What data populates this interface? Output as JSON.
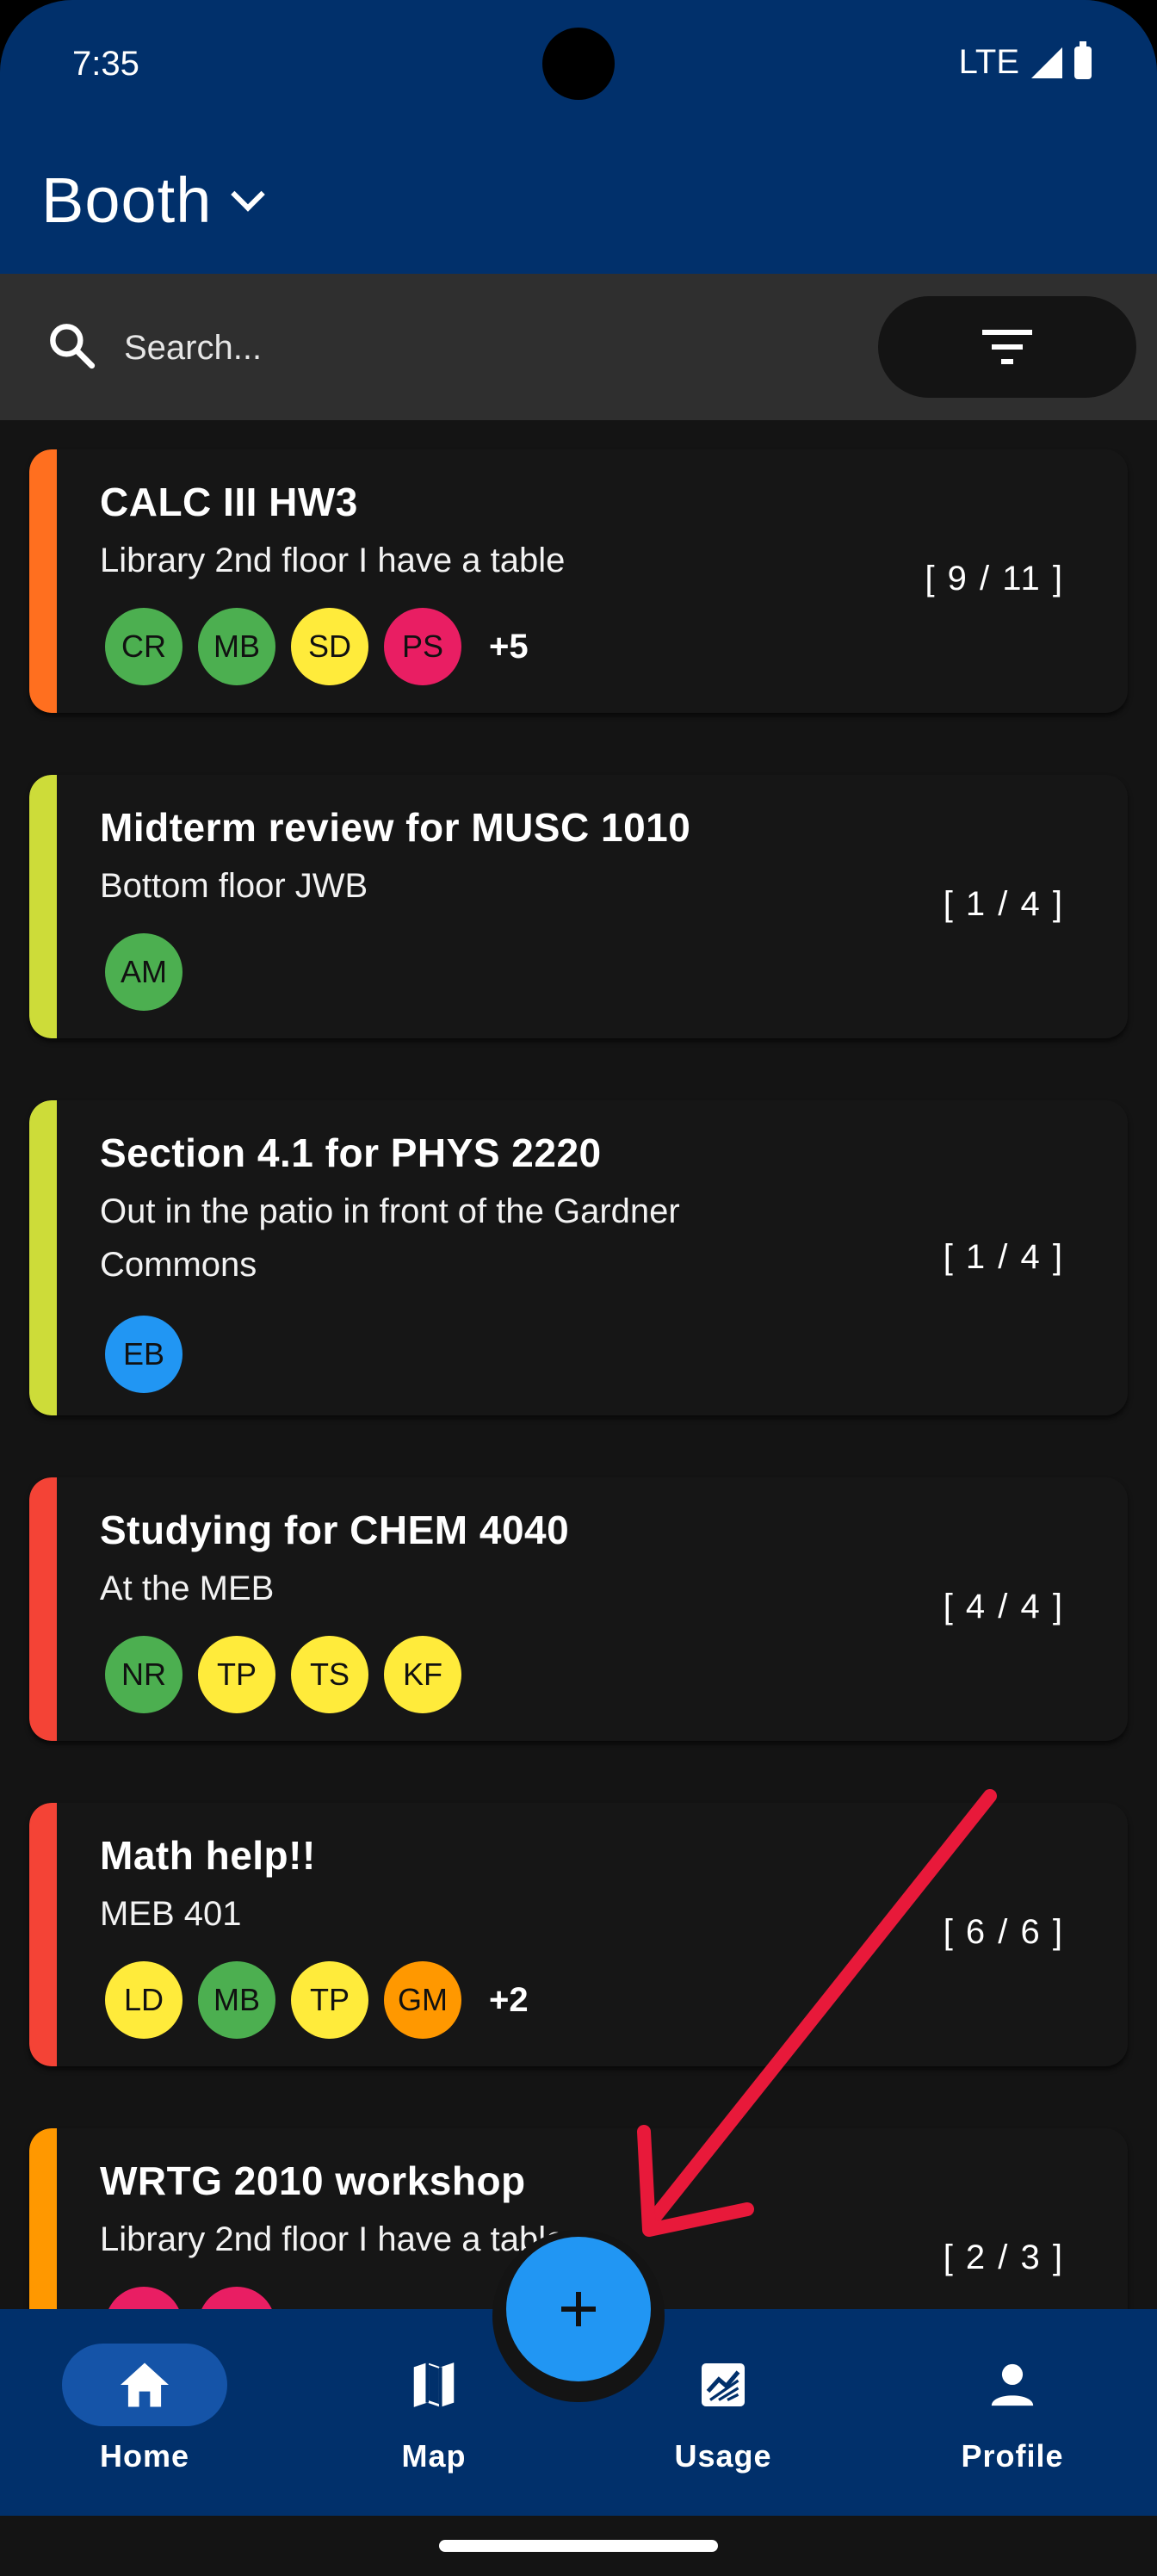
{
  "status_bar": {
    "time": "7:35",
    "network": "LTE"
  },
  "header": {
    "title": "Booth"
  },
  "search": {
    "placeholder": "Search..."
  },
  "colors": {
    "appbar": "#01306b",
    "fab": "#2196f3",
    "orange": "#ff6f1f",
    "lime": "#cddc39",
    "red": "#f44336",
    "amber": "#ff9800",
    "annotation": "#e8193a"
  },
  "cards": [
    {
      "title": "CALC III HW3",
      "location": "Library 2nd floor I have a table",
      "count": "[ 9 / 11 ]",
      "color": "#ff6f1f",
      "avatars": [
        {
          "initials": "CR",
          "color": "#4caf50"
        },
        {
          "initials": "MB",
          "color": "#4caf50"
        },
        {
          "initials": "SD",
          "color": "#ffeb3b"
        },
        {
          "initials": "PS",
          "color": "#e91e63"
        }
      ],
      "more": "+5"
    },
    {
      "title": "Midterm review for MUSC 1010",
      "location": "Bottom floor JWB",
      "count": "[ 1 / 4 ]",
      "color": "#cddc39",
      "avatars": [
        {
          "initials": "AM",
          "color": "#4caf50"
        }
      ],
      "more": ""
    },
    {
      "title": "Section 4.1 for PHYS 2220",
      "location": "Out in the patio in front of the Gardner Commons",
      "count": "[ 1 / 4 ]",
      "color": "#cddc39",
      "avatars": [
        {
          "initials": "EB",
          "color": "#2196f3"
        }
      ],
      "more": ""
    },
    {
      "title": "Studying for CHEM 4040",
      "location": "At the MEB",
      "count": "[ 4 / 4 ]",
      "color": "#f44336",
      "avatars": [
        {
          "initials": "NR",
          "color": "#4caf50"
        },
        {
          "initials": "TP",
          "color": "#ffeb3b"
        },
        {
          "initials": "TS",
          "color": "#ffeb3b"
        },
        {
          "initials": "KF",
          "color": "#ffeb3b"
        }
      ],
      "more": ""
    },
    {
      "title": "Math help!!",
      "location": "MEB 401",
      "count": "[ 6 / 6 ]",
      "color": "#f44336",
      "avatars": [
        {
          "initials": "LD",
          "color": "#ffeb3b"
        },
        {
          "initials": "MB",
          "color": "#4caf50"
        },
        {
          "initials": "TP",
          "color": "#ffeb3b"
        },
        {
          "initials": "GM",
          "color": "#ff9800"
        }
      ],
      "more": "+2"
    },
    {
      "title": "WRTG 2010 workshop",
      "location": "Library 2nd floor I have a table",
      "count": "[ 2 / 3 ]",
      "color": "#ff9800",
      "avatars": [
        {
          "initials": "",
          "color": "#e91e63"
        },
        {
          "initials": "",
          "color": "#e91e63"
        }
      ],
      "more": ""
    }
  ],
  "nav": {
    "home": "Home",
    "map": "Map",
    "usage": "Usage",
    "profile": "Profile",
    "icons": {
      "home": "home-icon",
      "map": "map-icon",
      "usage": "chart-icon",
      "profile": "person-icon",
      "fab": "add-icon"
    }
  }
}
